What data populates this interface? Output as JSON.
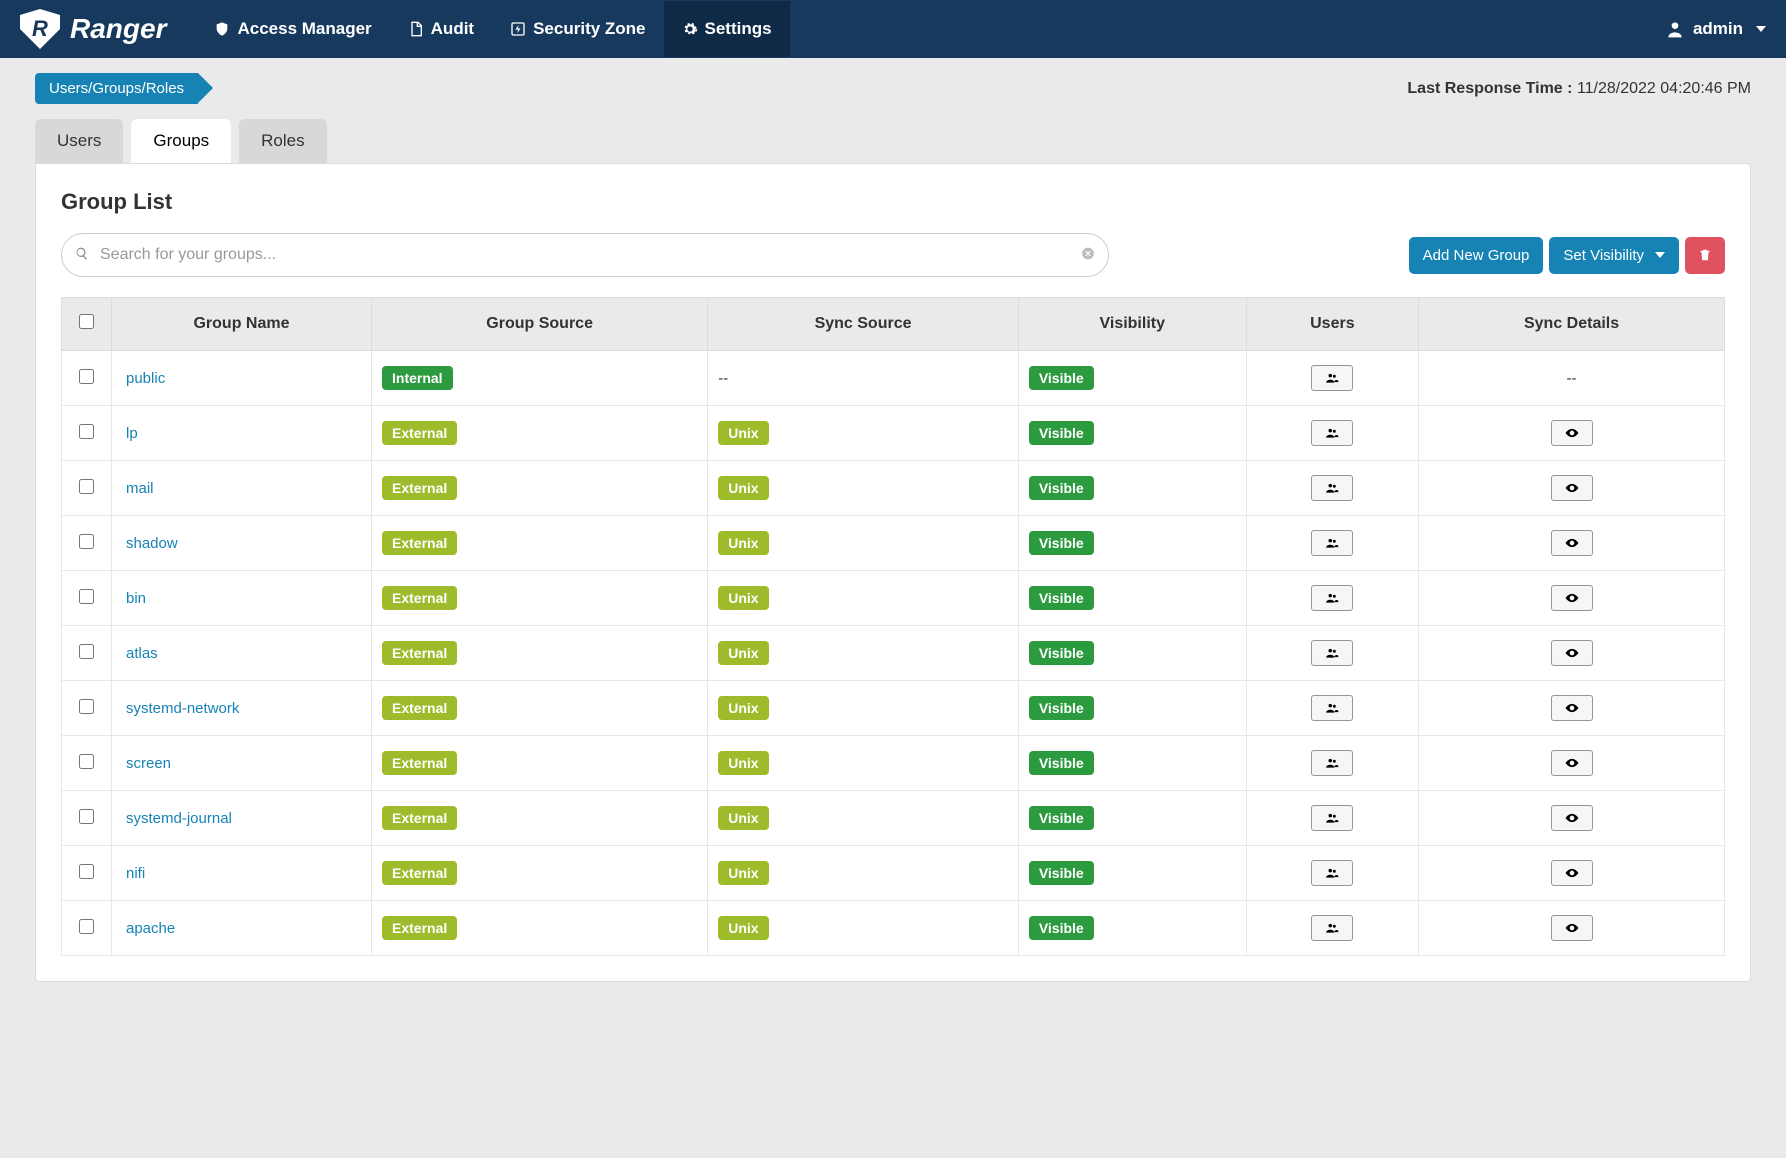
{
  "brand": "Ranger",
  "nav": {
    "items": [
      {
        "label": "Access Manager",
        "icon": "shield"
      },
      {
        "label": "Audit",
        "icon": "file"
      },
      {
        "label": "Security Zone",
        "icon": "lightning-box"
      },
      {
        "label": "Settings",
        "icon": "gear"
      }
    ],
    "active_index": 3,
    "user_label": "admin"
  },
  "breadcrumb": "Users/Groups/Roles",
  "response_time": {
    "label": "Last Response Time :",
    "value": "11/28/2022 04:20:46 PM"
  },
  "tabs": [
    {
      "label": "Users"
    },
    {
      "label": "Groups"
    },
    {
      "label": "Roles"
    }
  ],
  "active_tab_index": 1,
  "panel_title": "Group List",
  "search_placeholder": "Search for your groups...",
  "buttons": {
    "add": "Add New Group",
    "visibility": "Set Visibility"
  },
  "columns": [
    "Group Name",
    "Group Source",
    "Sync Source",
    "Visibility",
    "Users",
    "Sync Details"
  ],
  "rows": [
    {
      "name": "public",
      "source": "Internal",
      "sync_source": "--",
      "visibility": "Visible",
      "sync_details": "--"
    },
    {
      "name": "lp",
      "source": "External",
      "sync_source": "Unix",
      "visibility": "Visible",
      "sync_details": "eye"
    },
    {
      "name": "mail",
      "source": "External",
      "sync_source": "Unix",
      "visibility": "Visible",
      "sync_details": "eye"
    },
    {
      "name": "shadow",
      "source": "External",
      "sync_source": "Unix",
      "visibility": "Visible",
      "sync_details": "eye"
    },
    {
      "name": "bin",
      "source": "External",
      "sync_source": "Unix",
      "visibility": "Visible",
      "sync_details": "eye"
    },
    {
      "name": "atlas",
      "source": "External",
      "sync_source": "Unix",
      "visibility": "Visible",
      "sync_details": "eye"
    },
    {
      "name": "systemd-network",
      "source": "External",
      "sync_source": "Unix",
      "visibility": "Visible",
      "sync_details": "eye"
    },
    {
      "name": "screen",
      "source": "External",
      "sync_source": "Unix",
      "visibility": "Visible",
      "sync_details": "eye"
    },
    {
      "name": "systemd-journal",
      "source": "External",
      "sync_source": "Unix",
      "visibility": "Visible",
      "sync_details": "eye"
    },
    {
      "name": "nifi",
      "source": "External",
      "sync_source": "Unix",
      "visibility": "Visible",
      "sync_details": "eye"
    },
    {
      "name": "apache",
      "source": "External",
      "sync_source": "Unix",
      "visibility": "Visible",
      "sync_details": "eye"
    }
  ]
}
